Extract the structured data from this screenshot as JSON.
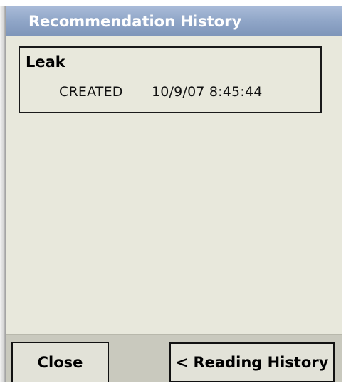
{
  "window": {
    "title": "Recommendation History"
  },
  "record": {
    "name": "Leak",
    "status": "CREATED",
    "timestamp": "10/9/07 8:45:44"
  },
  "buttons": {
    "close_label": "Close",
    "reading_history_label": "< Reading History"
  },
  "colors": {
    "title_bar": "#8fa5c7",
    "background": "#e8e8dc",
    "bottom_bar": "#c9c9be",
    "button_face": "#e2e2d8"
  }
}
